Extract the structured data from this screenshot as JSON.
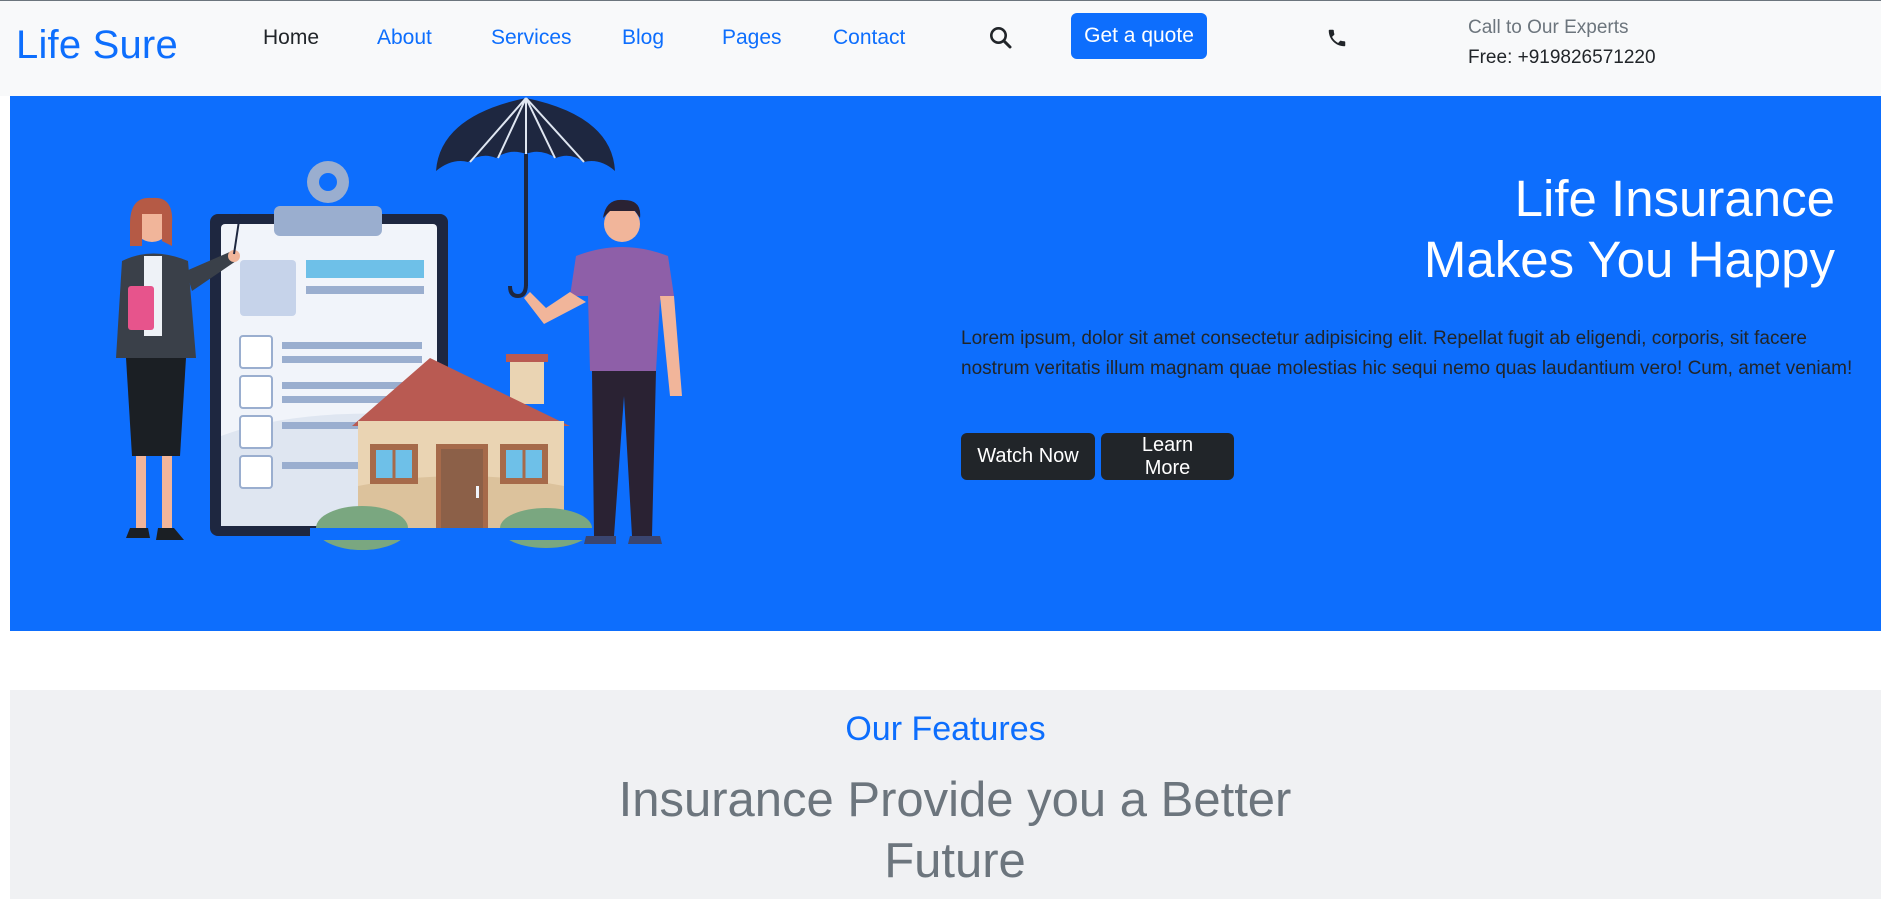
{
  "navbar": {
    "brand": "Life Sure",
    "links": [
      "Home",
      "About",
      "Services",
      "Blog",
      "Pages",
      "Contact"
    ],
    "active_link": "Home",
    "search_icon": "search-icon",
    "quote_button": "Get a quote",
    "phone_icon": "phone-icon",
    "call_label": "Call to Our Experts",
    "call_number": "Free: +919826571220"
  },
  "hero": {
    "title_line1": "Life Insurance",
    "title_line2": "Makes You Happy",
    "text": "Lorem ipsum, dolor sit amet consectetur adipisicing elit. Repellat fugit ab eligendi, corporis, sit facere nostrum veritatis illum magnam quae molestias hic sequi nemo quas laudantium vero! Cum, amet veniam!",
    "buttons": [
      "Watch Now",
      "Learn More"
    ],
    "illustration": "insurance-illustration"
  },
  "features": {
    "subtitle": "Our Features",
    "title_line1": "Insurance Provide you a Better",
    "title_line2": "Future"
  },
  "colors": {
    "primary": "#0d6efd",
    "dark": "#212529",
    "muted": "#6c757d",
    "navbar_bg": "#f8f9fa",
    "features_bg": "#f0f1f3"
  }
}
